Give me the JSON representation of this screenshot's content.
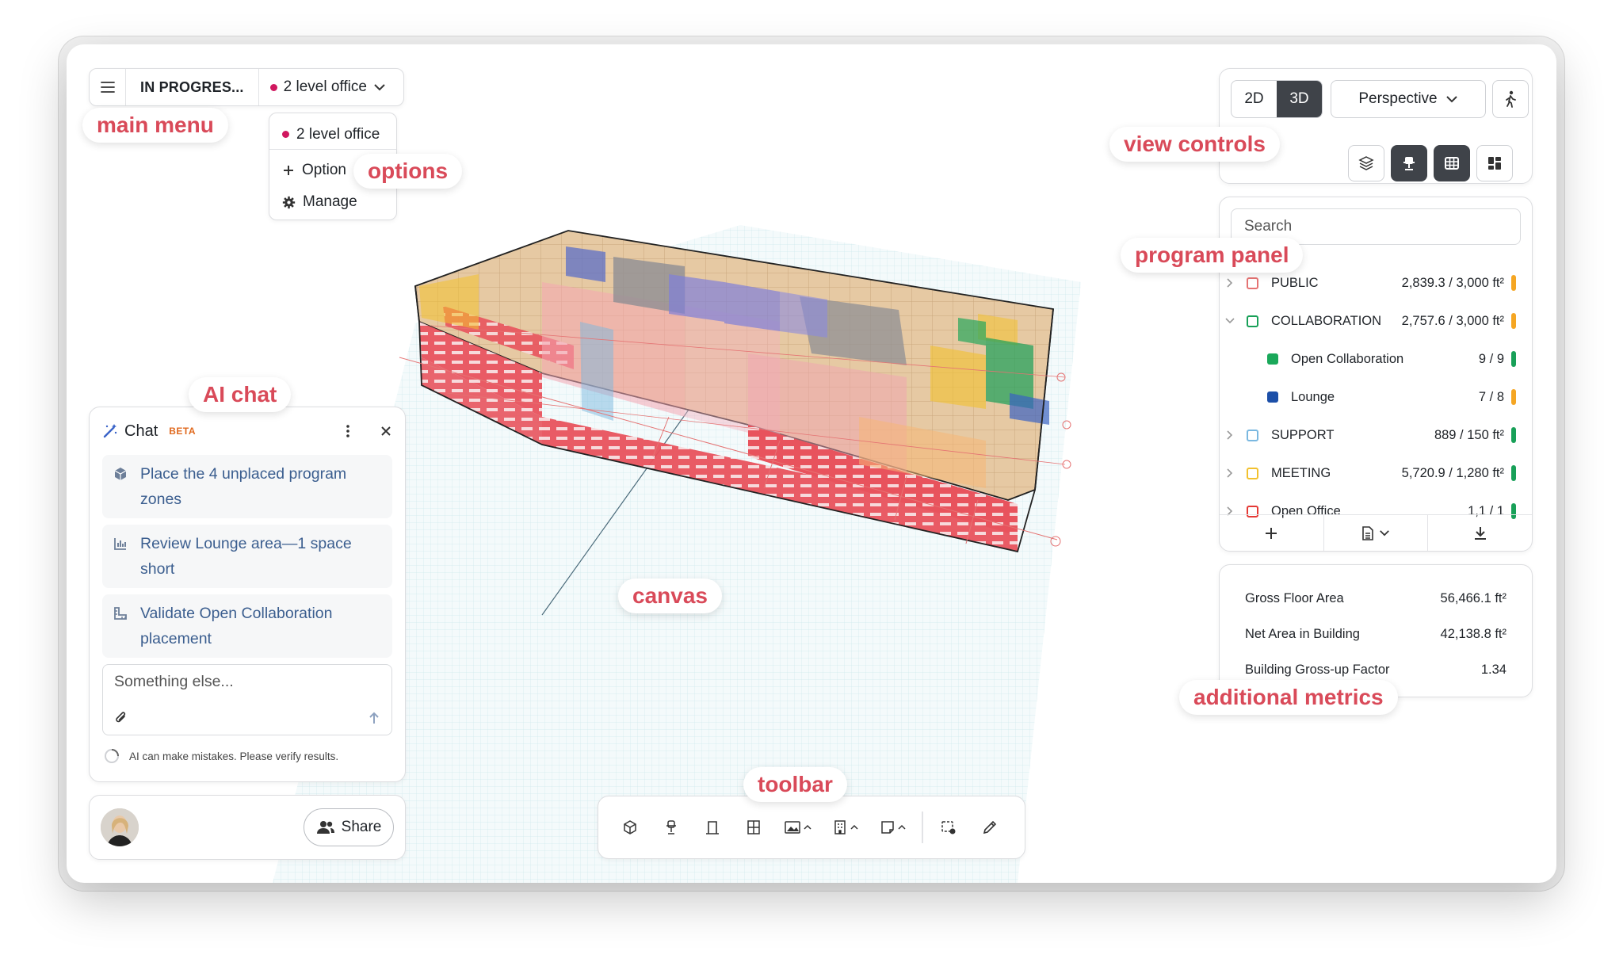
{
  "header": {
    "status": "IN PROGRES...",
    "option_name": "2 level office"
  },
  "options_menu": {
    "current": "2 level office",
    "add_label": "Option",
    "manage_label": "Manage"
  },
  "view_controls": {
    "mode_2d": "2D",
    "mode_3d": "3D",
    "active_mode": "3D",
    "projection": "Perspective"
  },
  "program_panel": {
    "search_placeholder": "Search",
    "items": [
      {
        "label": "PUBLIC",
        "value": "2,839.3 / 3,000 ft²",
        "color": "#e57373",
        "status": "#f5a623",
        "level": 0
      },
      {
        "label": "COLLABORATION",
        "value": "2,757.6 / 3,000 ft²",
        "color": "#18a058",
        "status": "#f5a623",
        "level": 0,
        "expanded": true
      },
      {
        "label": "Open Collaboration",
        "value": "9 / 9",
        "color": "#1aa85a",
        "status": "#18a058",
        "level": 1
      },
      {
        "label": "Lounge",
        "value": "7 / 8",
        "color": "#1c4fa8",
        "status": "#f5a623",
        "level": 1
      },
      {
        "label": "SUPPORT",
        "value": "889 / 150 ft²",
        "color": "#7ab8e0",
        "status": "#18a058",
        "level": 0
      },
      {
        "label": "MEETING",
        "value": "5,720.9 / 1,280 ft²",
        "color": "#f2c12e",
        "status": "#18a058",
        "level": 0
      },
      {
        "label": "Open Office",
        "value": "1,1 / 1",
        "color": "#e53935",
        "status": "#18a058",
        "level": 0
      }
    ]
  },
  "metrics": {
    "rows": [
      {
        "label": "Gross Floor Area",
        "value": "56,466.1 ft²"
      },
      {
        "label": "Net Area in Building",
        "value": "42,138.8 ft²"
      },
      {
        "label": "Building Gross-up Factor",
        "value": "1.34"
      }
    ]
  },
  "chat": {
    "title": "Chat",
    "badge": "BETA",
    "suggestions": [
      {
        "text": "Place the 4 unplaced program zones",
        "icon": "cube-icon"
      },
      {
        "text": "Review Lounge area—1 space short",
        "icon": "chart-icon"
      },
      {
        "text": "Validate Open Collaboration placement",
        "icon": "ruler-icon"
      }
    ],
    "input_placeholder": "Something else...",
    "disclaimer": "AI can make mistakes. Please verify results."
  },
  "user": {
    "share_label": "Share"
  },
  "annotations": {
    "main_menu": "main menu",
    "options": "options",
    "view_controls": "view controls",
    "program_panel": "program panel",
    "ai_chat": "AI chat",
    "canvas": "canvas",
    "additional_metrics": "additional metrics",
    "toolbar": "toolbar"
  },
  "toolbar": {
    "tools": [
      "box-icon",
      "desk-icon",
      "door-icon",
      "window-icon",
      "image-icon",
      "building-icon",
      "sticky-icon",
      "select-area-icon",
      "pencil-icon"
    ]
  }
}
